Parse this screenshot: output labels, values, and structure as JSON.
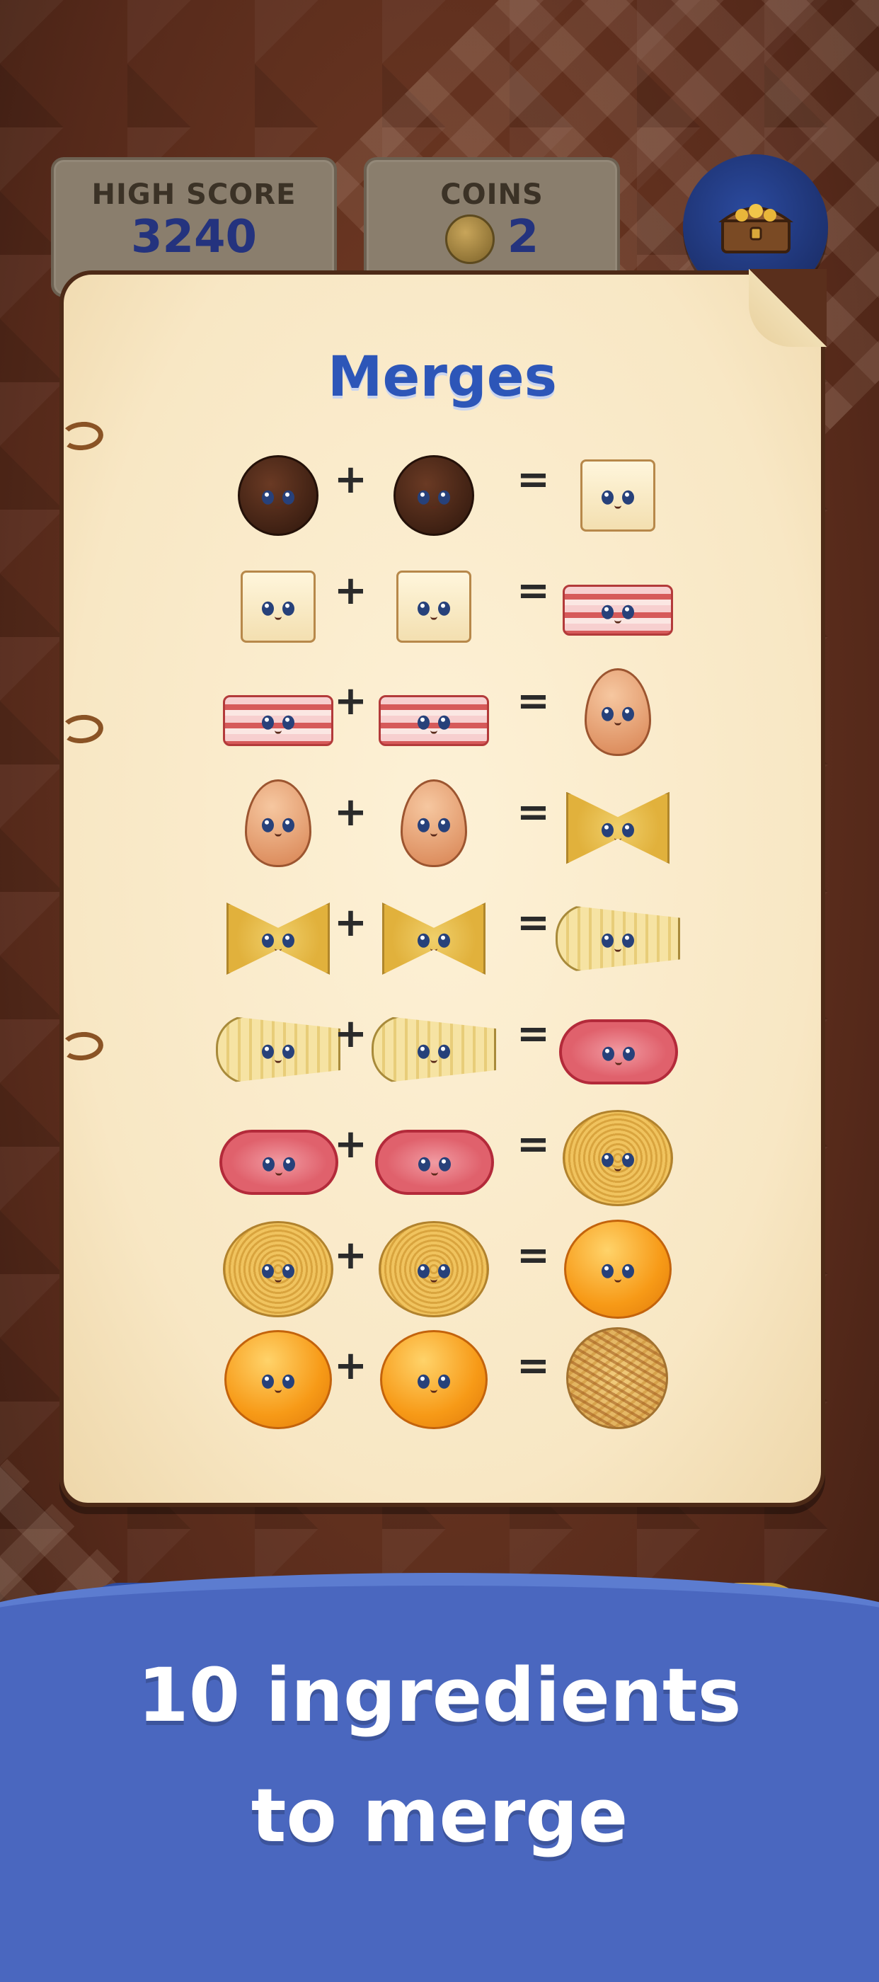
{
  "hud": {
    "high_score_label": "HIGH SCORE",
    "high_score_value": "3240",
    "coins_label": "COINS",
    "coins_value": "2",
    "chest_icon": "treasure-chest-icon"
  },
  "panel": {
    "title": "Merges",
    "rows": [
      {
        "a": "pepper",
        "b": "pepper",
        "result": "cheese"
      },
      {
        "a": "cheese",
        "b": "cheese",
        "result": "bacon"
      },
      {
        "a": "bacon",
        "b": "bacon",
        "result": "egg"
      },
      {
        "a": "egg",
        "b": "egg",
        "result": "farfalle"
      },
      {
        "a": "farfalle",
        "b": "farfalle",
        "result": "rigatoni"
      },
      {
        "a": "rigatoni",
        "b": "rigatoni",
        "result": "guanciale"
      },
      {
        "a": "guanciale",
        "b": "guanciale",
        "result": "spaghetti-nest"
      },
      {
        "a": "spaghetti-nest",
        "b": "spaghetti-nest",
        "result": "yolk"
      },
      {
        "a": "yolk",
        "b": "yolk",
        "result": "carbonara"
      }
    ],
    "plus": "+",
    "equals": "="
  },
  "banner": {
    "line1": "10 ingredients",
    "line2": "to merge"
  },
  "colors": {
    "title_blue": "#2d56b8",
    "banner_blue": "#4a67bf",
    "score_blue": "#24337e"
  }
}
